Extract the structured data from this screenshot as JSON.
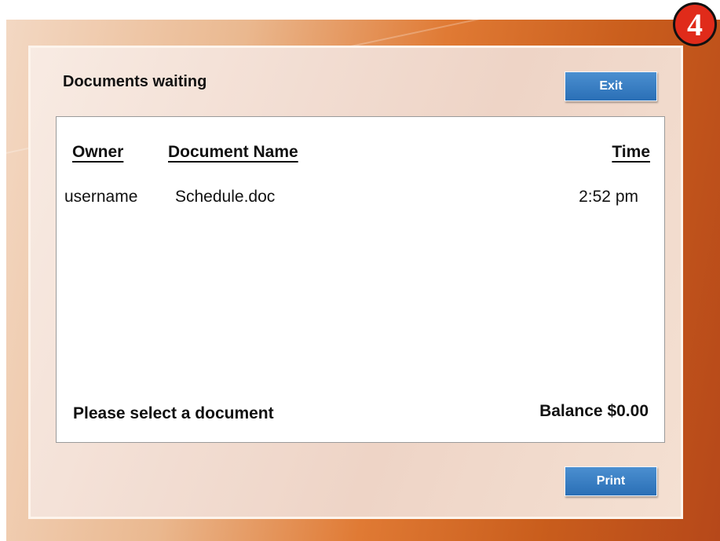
{
  "header": {
    "title": "Documents waiting",
    "exit_label": "Exit"
  },
  "table": {
    "columns": {
      "owner": "Owner",
      "name": "Document Name",
      "time": "Time"
    },
    "rows": [
      {
        "owner": "username",
        "name": "Schedule.doc",
        "time": "2:52 pm"
      }
    ]
  },
  "footer": {
    "status": "Please select a document",
    "balance": "Balance $0.00",
    "print_label": "Print"
  },
  "step_badge": "4",
  "colors": {
    "button": "#2a6fb6",
    "badge": "#e02b1a",
    "frame_accent": "#e07a34"
  }
}
